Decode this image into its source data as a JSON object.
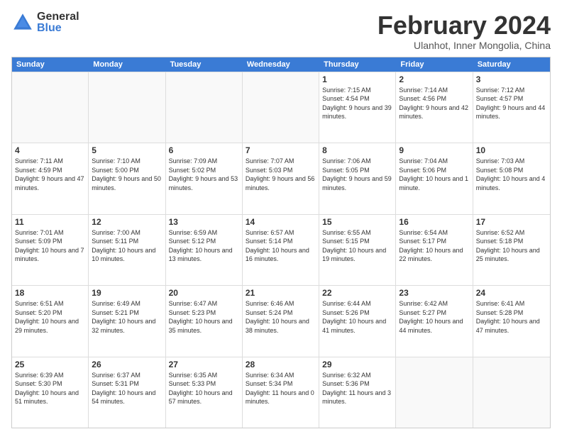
{
  "logo": {
    "general": "General",
    "blue": "Blue"
  },
  "title": "February 2024",
  "location": "Ulanhot, Inner Mongolia, China",
  "weekdays": [
    "Sunday",
    "Monday",
    "Tuesday",
    "Wednesday",
    "Thursday",
    "Friday",
    "Saturday"
  ],
  "rows": [
    [
      {
        "day": "",
        "empty": true
      },
      {
        "day": "",
        "empty": true
      },
      {
        "day": "",
        "empty": true
      },
      {
        "day": "",
        "empty": true
      },
      {
        "day": "1",
        "sunrise": "7:15 AM",
        "sunset": "4:54 PM",
        "daylight": "9 hours and 39 minutes."
      },
      {
        "day": "2",
        "sunrise": "7:14 AM",
        "sunset": "4:56 PM",
        "daylight": "9 hours and 42 minutes."
      },
      {
        "day": "3",
        "sunrise": "7:12 AM",
        "sunset": "4:57 PM",
        "daylight": "9 hours and 44 minutes."
      }
    ],
    [
      {
        "day": "4",
        "sunrise": "7:11 AM",
        "sunset": "4:59 PM",
        "daylight": "9 hours and 47 minutes."
      },
      {
        "day": "5",
        "sunrise": "7:10 AM",
        "sunset": "5:00 PM",
        "daylight": "9 hours and 50 minutes."
      },
      {
        "day": "6",
        "sunrise": "7:09 AM",
        "sunset": "5:02 PM",
        "daylight": "9 hours and 53 minutes."
      },
      {
        "day": "7",
        "sunrise": "7:07 AM",
        "sunset": "5:03 PM",
        "daylight": "9 hours and 56 minutes."
      },
      {
        "day": "8",
        "sunrise": "7:06 AM",
        "sunset": "5:05 PM",
        "daylight": "9 hours and 59 minutes."
      },
      {
        "day": "9",
        "sunrise": "7:04 AM",
        "sunset": "5:06 PM",
        "daylight": "10 hours and 1 minute."
      },
      {
        "day": "10",
        "sunrise": "7:03 AM",
        "sunset": "5:08 PM",
        "daylight": "10 hours and 4 minutes."
      }
    ],
    [
      {
        "day": "11",
        "sunrise": "7:01 AM",
        "sunset": "5:09 PM",
        "daylight": "10 hours and 7 minutes."
      },
      {
        "day": "12",
        "sunrise": "7:00 AM",
        "sunset": "5:11 PM",
        "daylight": "10 hours and 10 minutes."
      },
      {
        "day": "13",
        "sunrise": "6:59 AM",
        "sunset": "5:12 PM",
        "daylight": "10 hours and 13 minutes."
      },
      {
        "day": "14",
        "sunrise": "6:57 AM",
        "sunset": "5:14 PM",
        "daylight": "10 hours and 16 minutes."
      },
      {
        "day": "15",
        "sunrise": "6:55 AM",
        "sunset": "5:15 PM",
        "daylight": "10 hours and 19 minutes."
      },
      {
        "day": "16",
        "sunrise": "6:54 AM",
        "sunset": "5:17 PM",
        "daylight": "10 hours and 22 minutes."
      },
      {
        "day": "17",
        "sunrise": "6:52 AM",
        "sunset": "5:18 PM",
        "daylight": "10 hours and 25 minutes."
      }
    ],
    [
      {
        "day": "18",
        "sunrise": "6:51 AM",
        "sunset": "5:20 PM",
        "daylight": "10 hours and 29 minutes."
      },
      {
        "day": "19",
        "sunrise": "6:49 AM",
        "sunset": "5:21 PM",
        "daylight": "10 hours and 32 minutes."
      },
      {
        "day": "20",
        "sunrise": "6:47 AM",
        "sunset": "5:23 PM",
        "daylight": "10 hours and 35 minutes."
      },
      {
        "day": "21",
        "sunrise": "6:46 AM",
        "sunset": "5:24 PM",
        "daylight": "10 hours and 38 minutes."
      },
      {
        "day": "22",
        "sunrise": "6:44 AM",
        "sunset": "5:26 PM",
        "daylight": "10 hours and 41 minutes."
      },
      {
        "day": "23",
        "sunrise": "6:42 AM",
        "sunset": "5:27 PM",
        "daylight": "10 hours and 44 minutes."
      },
      {
        "day": "24",
        "sunrise": "6:41 AM",
        "sunset": "5:28 PM",
        "daylight": "10 hours and 47 minutes."
      }
    ],
    [
      {
        "day": "25",
        "sunrise": "6:39 AM",
        "sunset": "5:30 PM",
        "daylight": "10 hours and 51 minutes."
      },
      {
        "day": "26",
        "sunrise": "6:37 AM",
        "sunset": "5:31 PM",
        "daylight": "10 hours and 54 minutes."
      },
      {
        "day": "27",
        "sunrise": "6:35 AM",
        "sunset": "5:33 PM",
        "daylight": "10 hours and 57 minutes."
      },
      {
        "day": "28",
        "sunrise": "6:34 AM",
        "sunset": "5:34 PM",
        "daylight": "11 hours and 0 minutes."
      },
      {
        "day": "29",
        "sunrise": "6:32 AM",
        "sunset": "5:36 PM",
        "daylight": "11 hours and 3 minutes."
      },
      {
        "day": "",
        "empty": true
      },
      {
        "day": "",
        "empty": true
      }
    ]
  ]
}
